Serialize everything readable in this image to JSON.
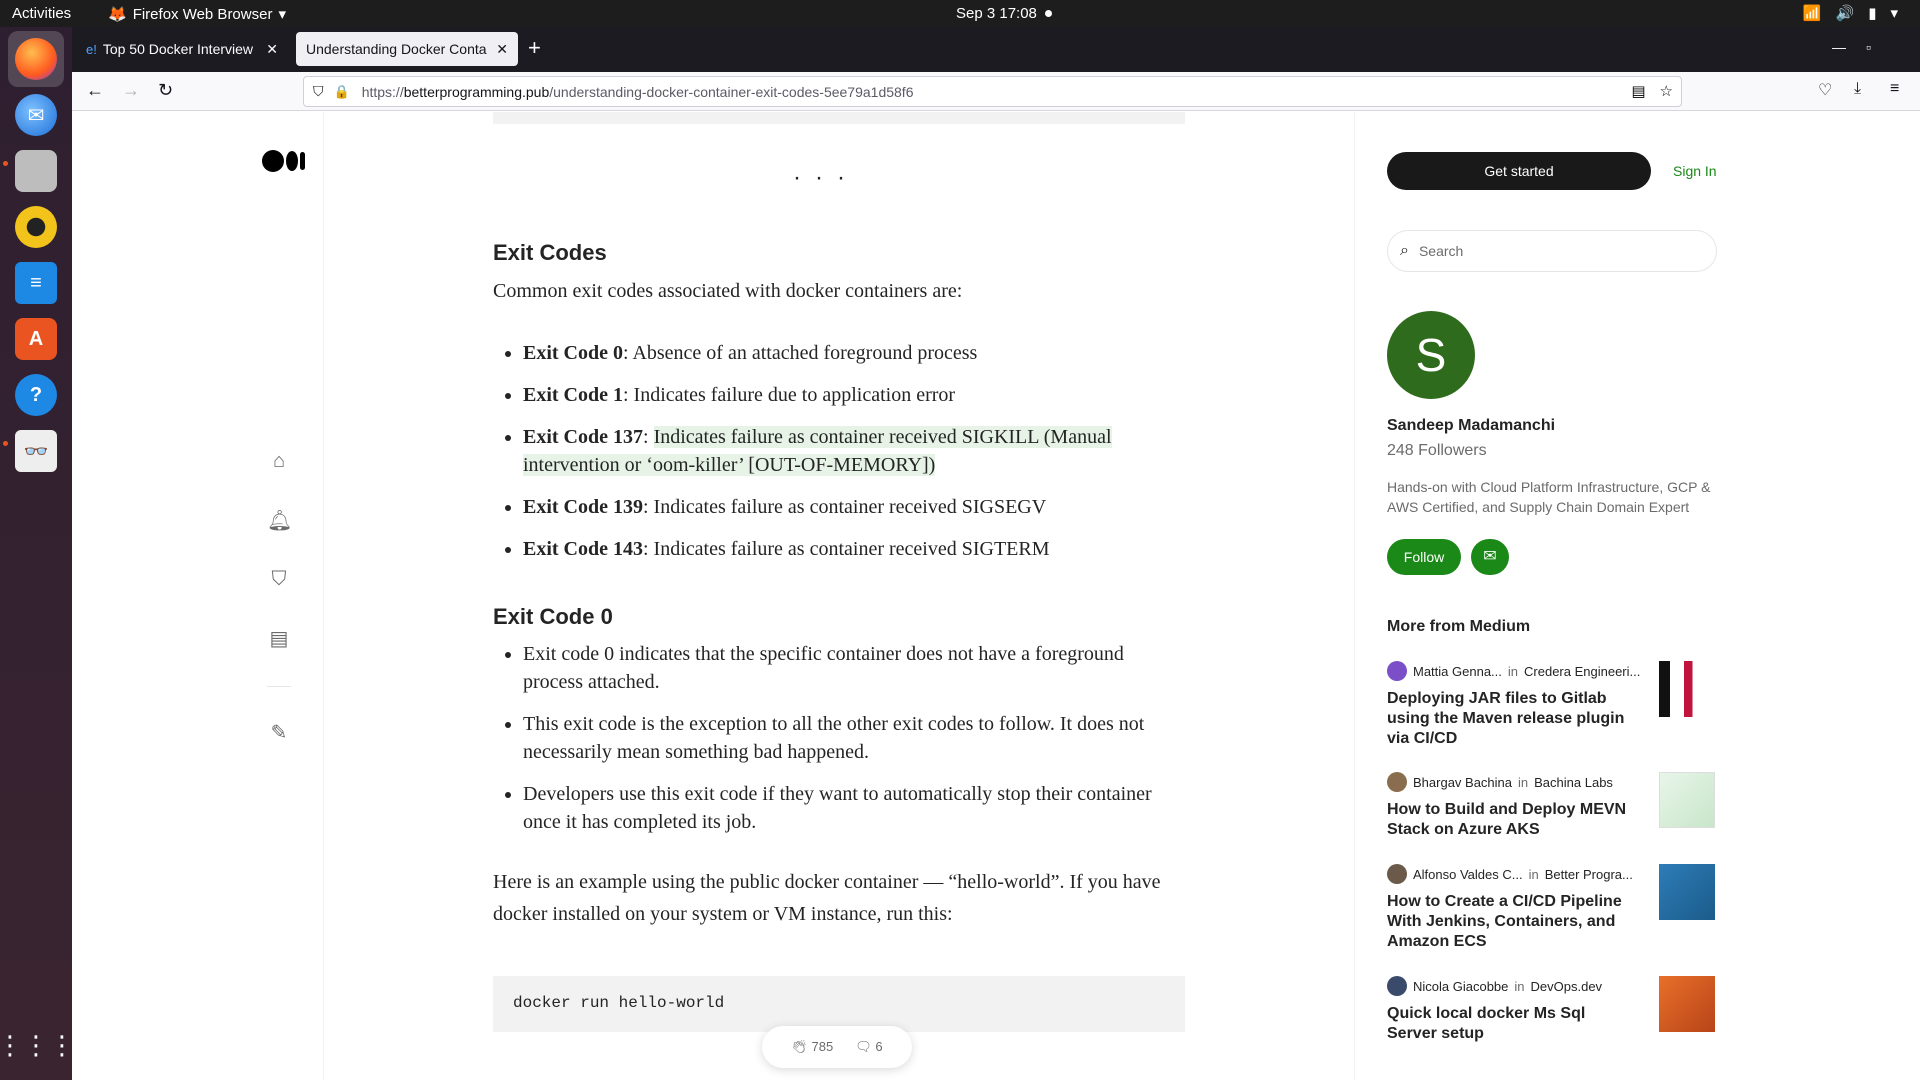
{
  "system": {
    "activities": "Activities",
    "app_menu": "Firefox Web Browser",
    "clock": "Sep 3  17:08"
  },
  "browser": {
    "tabs": [
      {
        "label": "Top 50 Docker Interview",
        "active": false
      },
      {
        "label": "Understanding Docker Conta",
        "active": true
      }
    ],
    "url_host": "betterprogramming.pub",
    "url_prefix": "https://",
    "url_path": "/understanding-docker-container-exit-codes-5ee79a1d58f6"
  },
  "article": {
    "heading_exit_codes": "Exit Codes",
    "intro": "Common exit codes associated with docker containers are:",
    "codes": [
      {
        "code": "Exit Code 0",
        "desc": ": Absence of an attached foreground process"
      },
      {
        "code": "Exit Code 1",
        "desc": ": Indicates failure due to application error"
      },
      {
        "code": "Exit Code 137",
        "desc": "Indicates failure as container received SIGKILL (Manual intervention or ‘oom-killer’ [OUT-OF-MEMORY])",
        "sep": ": "
      },
      {
        "code": "Exit Code 139",
        "desc": ": Indicates failure as container received SIGSEGV"
      },
      {
        "code": "Exit Code 143",
        "desc": ": Indicates failure as container received SIGTERM"
      }
    ],
    "heading_exit_code0": "Exit Code 0",
    "code0_points": [
      "Exit code 0 indicates that the specific container does not have a foreground process attached.",
      "This exit code is the exception to all the other exit codes to follow. It does not necessarily mean something bad happened.",
      "Developers use this exit code if they want to automatically stop their container once it has completed its job."
    ],
    "example_para": "Here is an example using the public docker container — “hello-world”. If you have docker installed on your system or VM instance, run this:",
    "code_sample": "docker run hello-world",
    "claps": "785",
    "responses": "6"
  },
  "sidebar": {
    "get_started": "Get started",
    "sign_in": "Sign In",
    "search_placeholder": "Search",
    "avatar_letter": "S",
    "author": "Sandeep Madamanchi",
    "followers": "248 Followers",
    "bio": "Hands-on with Cloud Platform Infrastructure, GCP & AWS Certified, and Supply Chain Domain Expert",
    "follow": "Follow",
    "more_from": "More from Medium",
    "recs": [
      {
        "author": "Mattia Genna...",
        "in": "in",
        "pub": "Credera Engineeri...",
        "title": "Deploying JAR files to Gitlab using the Maven release plugin via CI/CD"
      },
      {
        "author": "Bhargav Bachina",
        "in": "in",
        "pub": "Bachina Labs",
        "title": "How to Build and Deploy MEVN Stack on Azure AKS"
      },
      {
        "author": "Alfonso Valdes C...",
        "in": "in",
        "pub": "Better Progra...",
        "title": "How to Create a CI/CD Pipeline With Jenkins, Containers, and Amazon ECS"
      },
      {
        "author": "Nicola Giacobbe",
        "in": "in",
        "pub": "DevOps.dev",
        "title": "Quick local docker Ms Sql Server setup"
      }
    ]
  }
}
